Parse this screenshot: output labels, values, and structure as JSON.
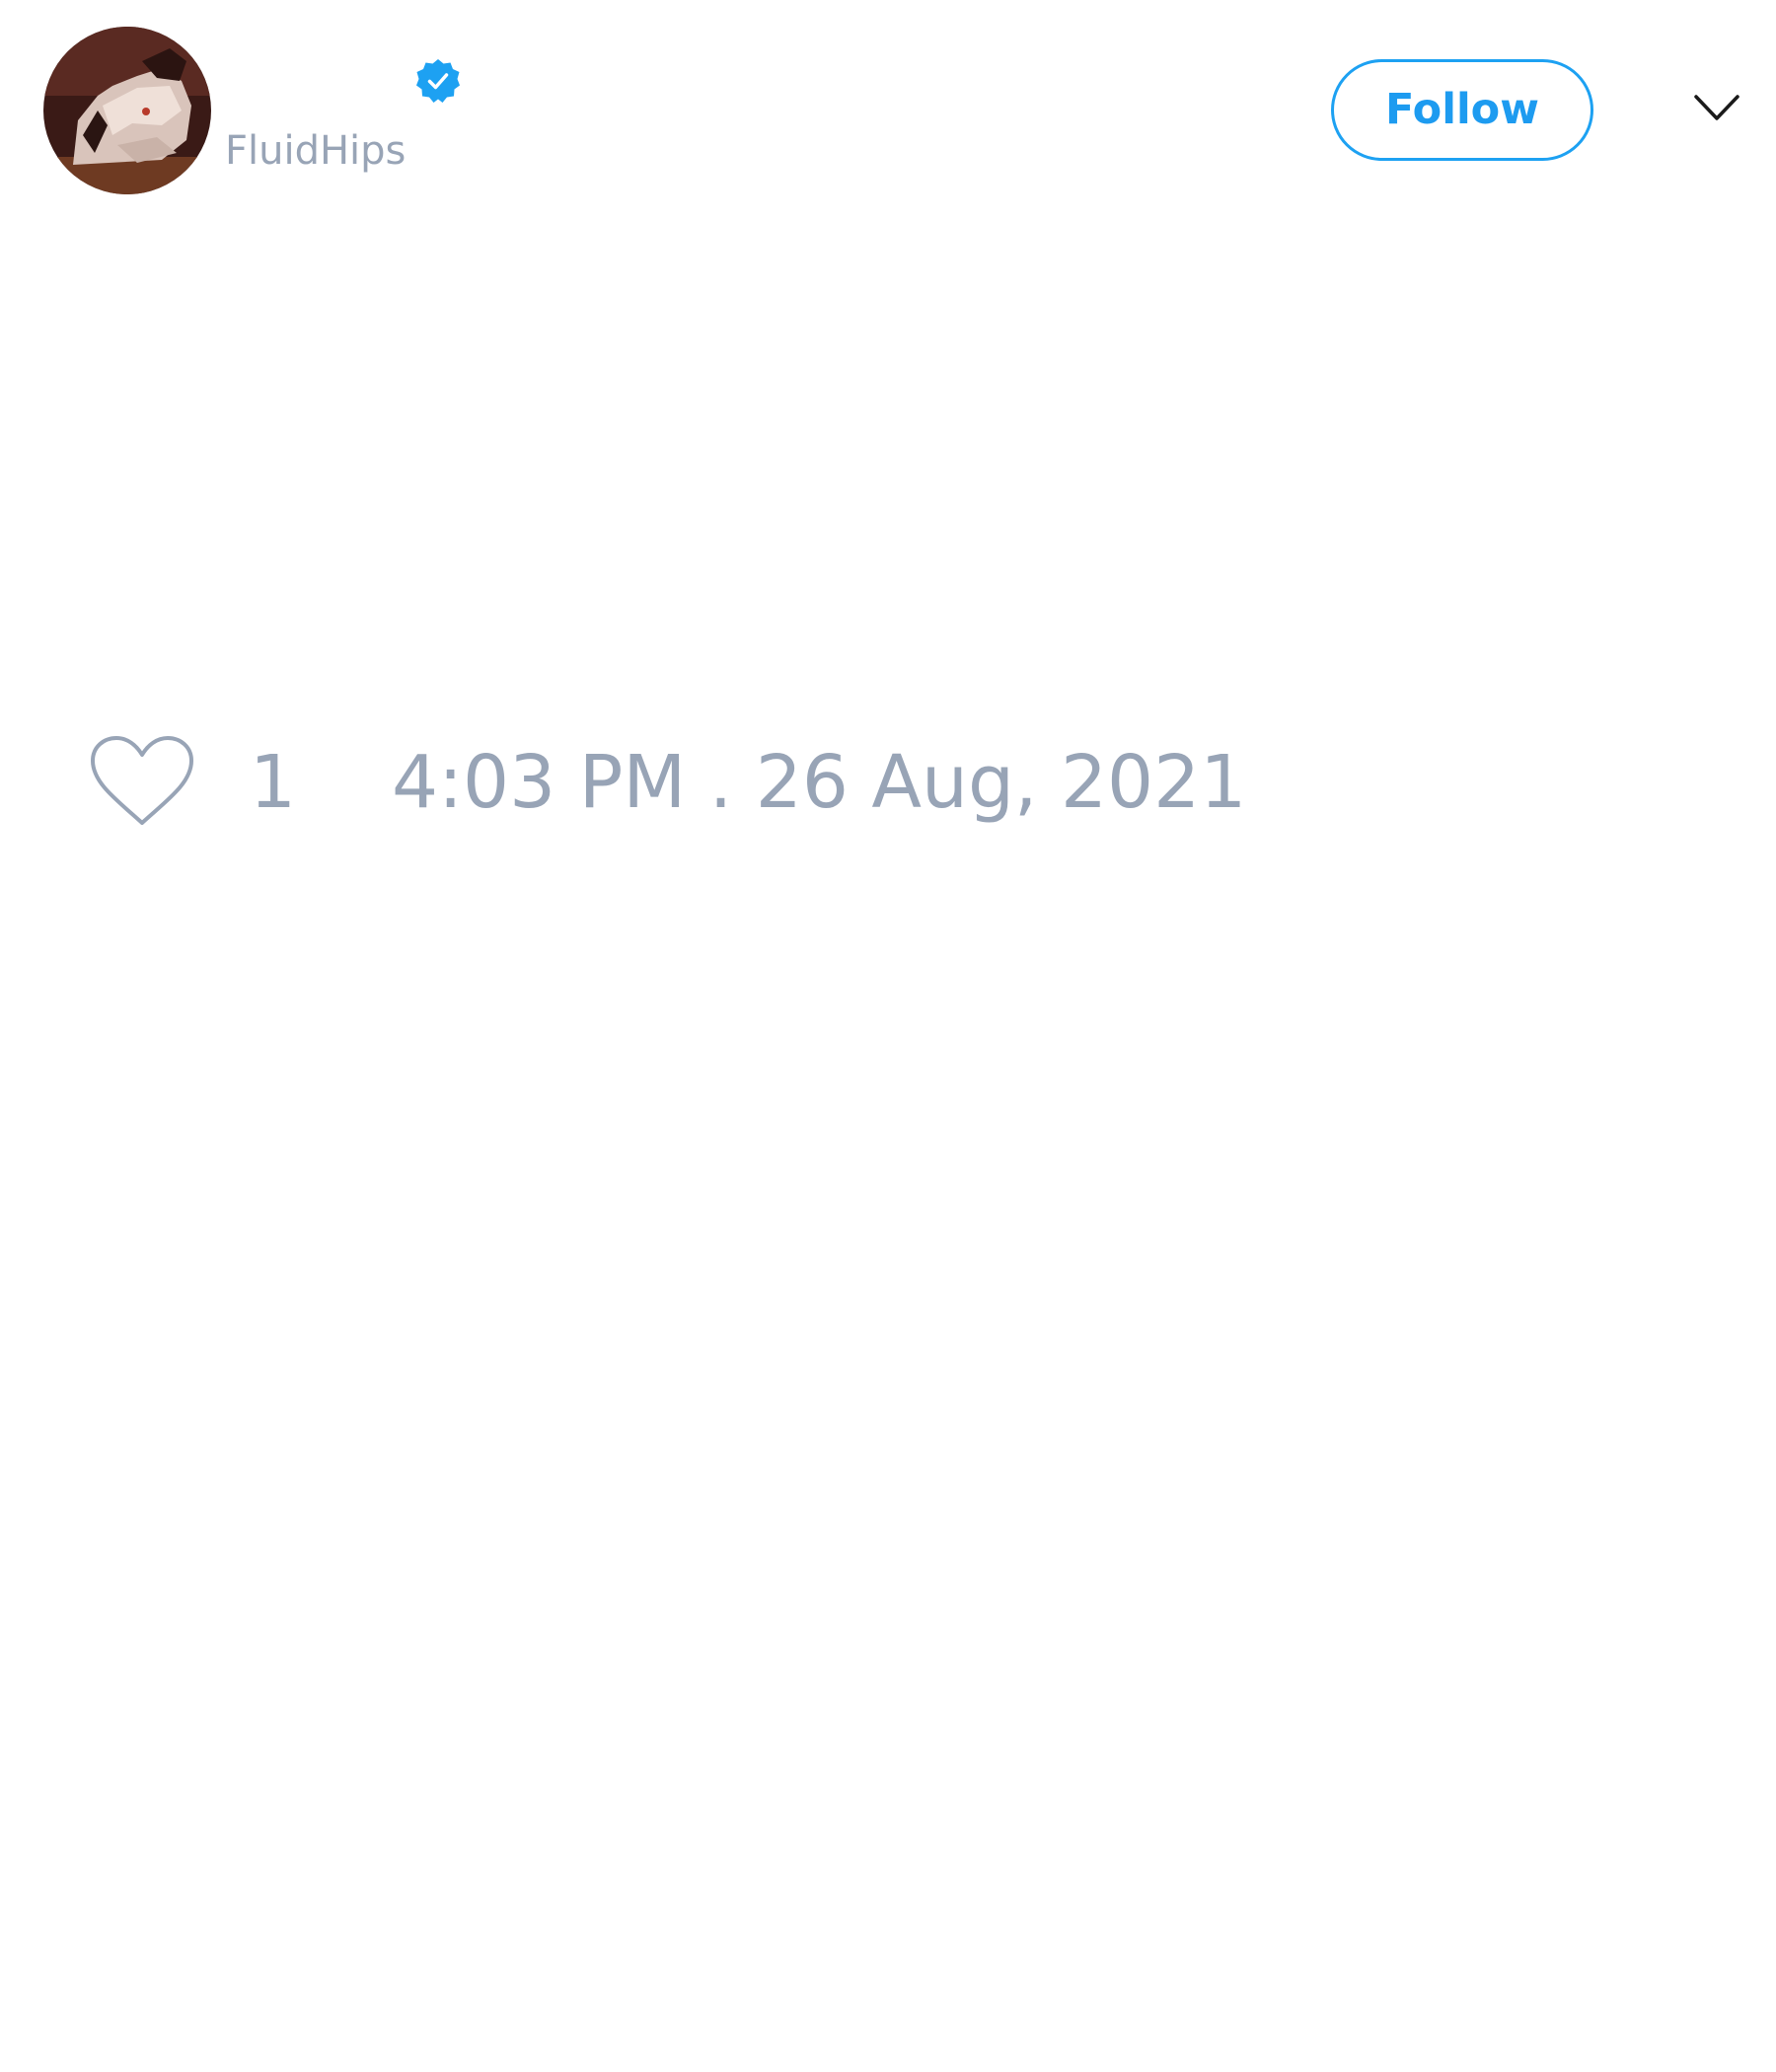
{
  "author": {
    "handle": "FluidHips",
    "verified": true,
    "verified_icon": "verified-badge-icon",
    "avatar": "avatar-image"
  },
  "actions": {
    "follow_label": "Follow",
    "menu_icon": "chevron-down-icon"
  },
  "tweet": {
    "like_icon": "heart-outline-icon",
    "like_count": "1",
    "timestamp": "4:03 PM . 26 Aug, 2021"
  },
  "colors": {
    "accent": "#1da1f2",
    "muted_text": "#98a4b6",
    "background": "#ffffff"
  }
}
